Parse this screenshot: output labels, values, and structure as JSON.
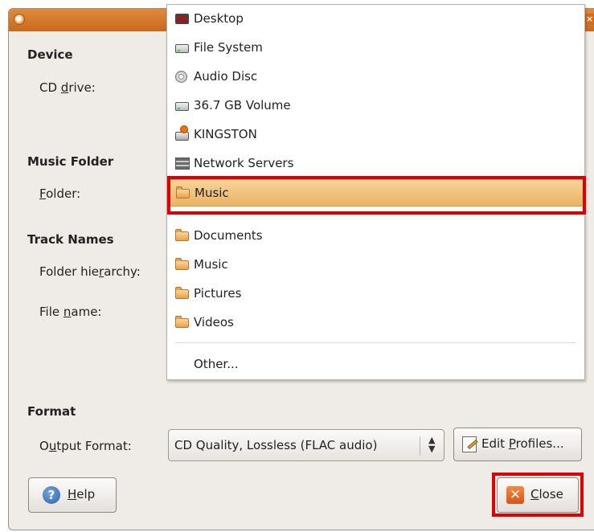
{
  "dialog": {
    "sections": {
      "device": "Device",
      "music_folder": "Music Folder",
      "track_names": "Track Names",
      "format": "Format"
    },
    "labels": {
      "cd_drive": {
        "pre": "CD ",
        "mn": "d",
        "post": "rive:"
      },
      "folder": {
        "pre": "",
        "mn": "F",
        "post": "older:"
      },
      "folder_hierarchy": {
        "pre": "Folder hie",
        "mn": "r",
        "post": "archy:"
      },
      "file_name": {
        "pre": "File ",
        "mn": "n",
        "post": "ame:"
      },
      "output_format": {
        "pre": "O",
        "mn": "u",
        "post": "tput Format:"
      }
    },
    "output_format_value": "CD Quality, Lossless (FLAC audio)",
    "edit_profiles_button": {
      "pre": "Edit ",
      "mn": "P",
      "post": "rofiles..."
    },
    "help_button": {
      "pre": "",
      "mn": "H",
      "post": "elp"
    },
    "close_button": {
      "pre": "",
      "mn": "C",
      "post": "lose"
    }
  },
  "folder_menu": {
    "items": [
      {
        "label": "Desktop",
        "icon": "desktop-icon"
      },
      {
        "label": "File System",
        "icon": "drive-icon"
      },
      {
        "label": "Audio Disc",
        "icon": "audio-disc-icon"
      },
      {
        "label": "36.7 GB Volume",
        "icon": "drive-icon"
      },
      {
        "label": "KINGSTON",
        "icon": "usb-drive-icon"
      },
      {
        "label": "Network Servers",
        "icon": "network-icon"
      },
      {
        "label": "Music",
        "icon": "folder-icon",
        "selected": true
      },
      {
        "label": "Documents",
        "icon": "folder-icon"
      },
      {
        "label": "Music",
        "icon": "folder-icon"
      },
      {
        "label": "Pictures",
        "icon": "folder-icon"
      },
      {
        "label": "Videos",
        "icon": "folder-icon"
      },
      {
        "label": "Other...",
        "icon": ""
      }
    ]
  },
  "colors": {
    "highlight_box": "#e00000",
    "selection": "#e9b463",
    "titlebar": "#d9782c"
  }
}
